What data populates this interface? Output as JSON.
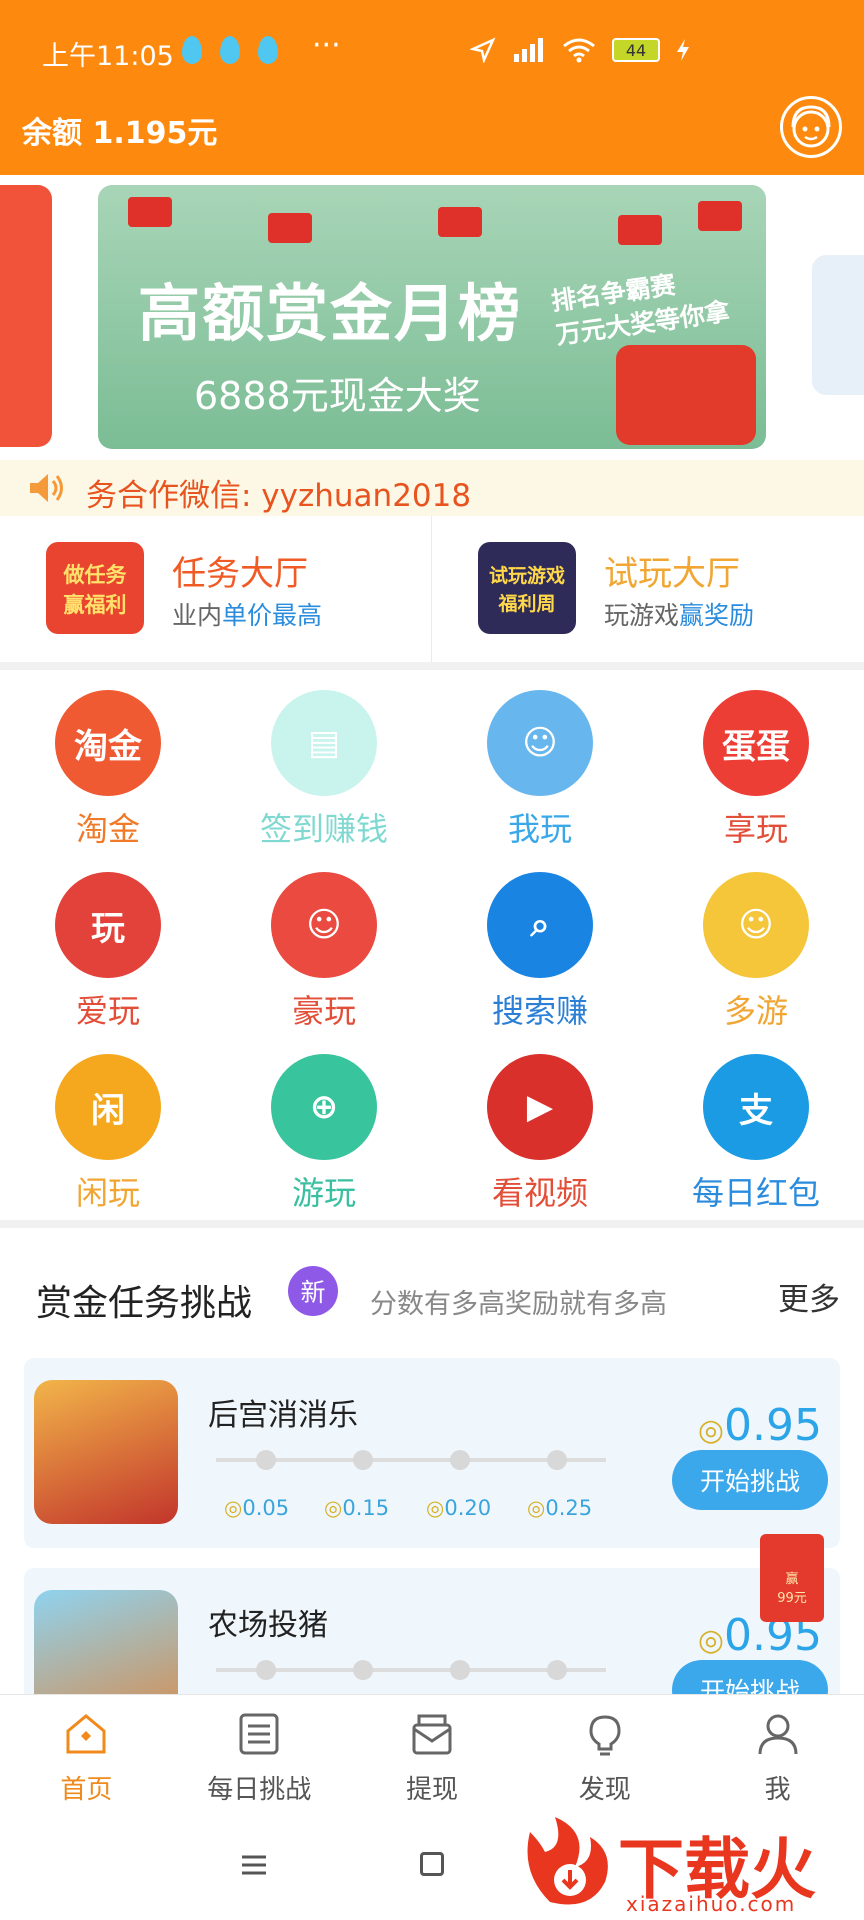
{
  "status_bar": {
    "time": "上午11:05",
    "dots": "···",
    "battery": "44"
  },
  "header": {
    "balance": "余额 1.195元",
    "customer_service_icon": "customer-service-icon"
  },
  "banner": {
    "title": "高额赏金月榜",
    "subtitle": "6888元现金大奖",
    "tag_line1": "排名争霸赛",
    "tag_line2": "万元大奖等你拿"
  },
  "notice": {
    "text": "务合作微信: yyzhuan2018"
  },
  "halls": [
    {
      "title": "任务大厅",
      "sub_prefix": "业内",
      "sub_highlight": "单价最高",
      "title_color": "#f05a24",
      "img_text1": "做任务",
      "img_text2": "赢福利"
    },
    {
      "title": "试玩大厅",
      "sub_prefix": "玩游戏",
      "sub_highlight": "赢奖励",
      "title_color": "#f1a633",
      "img_text1": "试玩游戏",
      "img_text2": "福利周"
    }
  ],
  "grid": [
    {
      "label": "淘金",
      "color": "#f07a2a",
      "icon_bg": "#ef5a33",
      "icon_text": "淘金"
    },
    {
      "label": "签到赚钱",
      "color": "#7fd9d0",
      "icon_bg": "#c9f4ee",
      "icon_text": "▤"
    },
    {
      "label": "我玩",
      "color": "#3aa8e8",
      "icon_bg": "#67b7ee",
      "icon_text": "☺"
    },
    {
      "label": "享玩",
      "color": "#e24e37",
      "icon_bg": "#ec3e35",
      "icon_text": "蛋蛋"
    },
    {
      "label": "爱玩",
      "color": "#e24e37",
      "icon_bg": "#e2423a",
      "icon_text": "玩"
    },
    {
      "label": "豪玩",
      "color": "#e24e37",
      "icon_bg": "#ea4a40",
      "icon_text": "☺"
    },
    {
      "label": "搜索赚",
      "color": "#2b7fd6",
      "icon_bg": "#1a84e3",
      "icon_text": "⌕"
    },
    {
      "label": "多游",
      "color": "#f1a633",
      "icon_bg": "#f5c63a",
      "icon_text": "☺"
    },
    {
      "label": "闲玩",
      "color": "#f1a633",
      "icon_bg": "#f5a81e",
      "icon_text": "闲"
    },
    {
      "label": "游玩",
      "color": "#3bbfa1",
      "icon_bg": "#38c49d",
      "icon_text": "⊕"
    },
    {
      "label": "看视频",
      "color": "#e24e37",
      "icon_bg": "#d9302c",
      "icon_text": "▶"
    },
    {
      "label": "每日红包",
      "color": "#2b8cde",
      "icon_bg": "#1a9be3",
      "icon_text": "支"
    }
  ],
  "challenge": {
    "title": "赏金任务挑战",
    "new_badge": "新",
    "desc": "分数有多高奖励就有多高",
    "more": "更多",
    "cards": [
      {
        "name": "后宫消消乐",
        "price": "0.95",
        "button": "开始挑战",
        "rewards": [
          "0.05",
          "0.15",
          "0.20",
          "0.25"
        ]
      },
      {
        "name": "农场投猪",
        "price": "0.95",
        "button": "开始挑战",
        "rewards": []
      }
    ],
    "coin_symbol": "◎"
  },
  "float_redpack": {
    "line1": "赢",
    "line2": "99元"
  },
  "bottom_nav": [
    {
      "label": "首页",
      "icon": "home-icon"
    },
    {
      "label": "每日挑战",
      "icon": "list-icon"
    },
    {
      "label": "提现",
      "icon": "withdraw-icon"
    },
    {
      "label": "发现",
      "icon": "lightbulb-icon"
    },
    {
      "label": "我",
      "icon": "profile-icon"
    }
  ],
  "watermark": {
    "brand": "下载火",
    "url": "xiazaihuo.com"
  }
}
